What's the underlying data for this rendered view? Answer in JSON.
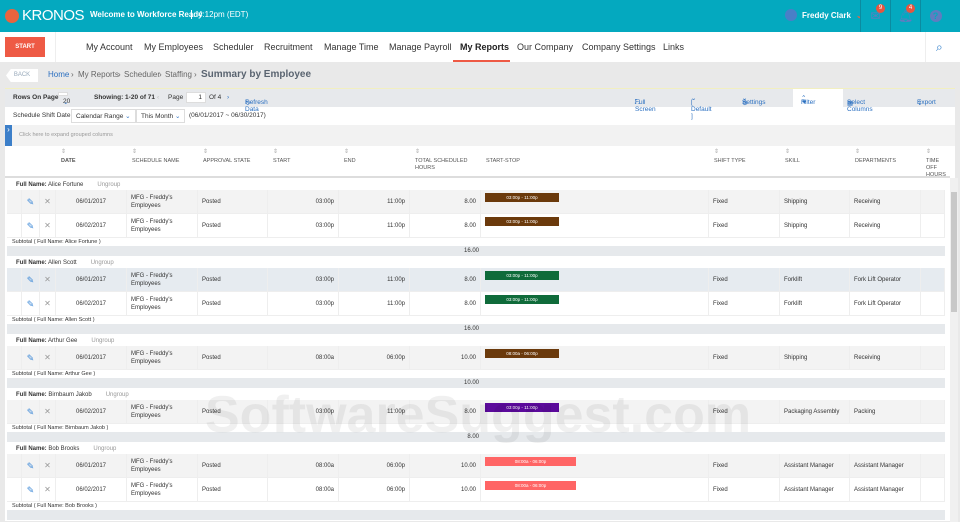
{
  "header": {
    "logo": "KRONOS",
    "welcome": "Welcome to Workforce Ready",
    "time": "4:12pm (EDT)",
    "user": "Freddy Clark",
    "mail_badge": "9",
    "bell_badge": "4"
  },
  "nav": {
    "start": "START",
    "items": [
      "My Account",
      "My Employees",
      "Scheduler",
      "Recruitment",
      "Manage Time",
      "Manage Payroll",
      "My Reports",
      "Our Company",
      "Company Settings",
      "Links"
    ],
    "active": "My Reports"
  },
  "breadcrumb": {
    "back": "BACK",
    "items": [
      "Home",
      "My Reports",
      "Scheduler",
      "Staffing"
    ],
    "title": "Summary by Employee"
  },
  "toolbar": {
    "rows_label": "Rows On Page",
    "rows_value": "20",
    "showing": "Showing: 1-20 of 71",
    "page_label": "Page",
    "page_value": "1",
    "of": "Of 4",
    "refresh": "Refresh Data",
    "full_screen": "Full Screen",
    "view": "[ Default ]",
    "settings": "Settings",
    "filter": "Filter",
    "select_columns": "Select Columns",
    "export": "Export"
  },
  "filter": {
    "label": "Schedule Shift Date:",
    "range": "Calendar Range",
    "period": "This Month",
    "dates": "(06/01/2017 ~ 06/30/2017)"
  },
  "expand_hint": "Click here to expand grouped columns",
  "columns": [
    "Date",
    "Schedule Name",
    "Approval State",
    "Start",
    "End",
    "Total Scheduled Hours",
    "Start-Stop",
    "Shift Type",
    "Skill",
    "Departments",
    "Time Off Hours"
  ],
  "groups": [
    {
      "label": "Full Name:",
      "name": "Alice Fortune",
      "ungroup": "Ungroup",
      "subtotal": "Subtotal ( Full Name: Alice Fortune )",
      "total": "16.00",
      "rows": [
        {
          "date": "06/01/2017",
          "schedule": "MFG - Freddy's Employees",
          "state": "Posted",
          "start": "03:00p",
          "end": "11:00p",
          "hours": "8.00",
          "bar": "03:00p - 11:00p",
          "color": "#6b3a0c",
          "shift": "Fixed",
          "skill": "Shipping",
          "dept": "Receiving"
        },
        {
          "date": "06/02/2017",
          "schedule": "MFG - Freddy's Employees",
          "state": "Posted",
          "start": "03:00p",
          "end": "11:00p",
          "hours": "8.00",
          "bar": "03:00p - 11:00p",
          "color": "#6b3a0c",
          "shift": "Fixed",
          "skill": "Shipping",
          "dept": "Receiving"
        }
      ]
    },
    {
      "label": "Full Name:",
      "name": "Allen Scott",
      "ungroup": "Ungroup",
      "subtotal": "Subtotal ( Full Name: Allen Scott )",
      "total": "16.00",
      "rows": [
        {
          "date": "06/01/2017",
          "schedule": "MFG - Freddy's Employees",
          "state": "Posted",
          "start": "03:00p",
          "end": "11:00p",
          "hours": "8.00",
          "bar": "03:00p - 11:00p",
          "color": "#0f6b3a",
          "shift": "Fixed",
          "skill": "Forklift",
          "dept": "Fork Lift Operator"
        },
        {
          "date": "06/02/2017",
          "schedule": "MFG - Freddy's Employees",
          "state": "Posted",
          "start": "03:00p",
          "end": "11:00p",
          "hours": "8.00",
          "bar": "03:00p - 11:00p",
          "color": "#0f6b3a",
          "shift": "Fixed",
          "skill": "Forklift",
          "dept": "Fork Lift Operator"
        }
      ]
    },
    {
      "label": "Full Name:",
      "name": "Arthur Gee",
      "ungroup": "Ungroup",
      "subtotal": "Subtotal ( Full Name: Arthur Gee )",
      "total": "10.00",
      "rows": [
        {
          "date": "06/01/2017",
          "schedule": "MFG - Freddy's Employees",
          "state": "Posted",
          "start": "08:00a",
          "end": "06:00p",
          "hours": "10.00",
          "bar": "08:00a - 06:00p",
          "color": "#6b3a0c",
          "shift": "Fixed",
          "skill": "Shipping",
          "dept": "Receiving"
        }
      ]
    },
    {
      "label": "Full Name:",
      "name": "Birnbaum Jakob",
      "ungroup": "Ungroup",
      "subtotal": "Subtotal ( Full Name: Birnbaum Jakob )",
      "total": "8.00",
      "rows": [
        {
          "date": "06/02/2017",
          "schedule": "MFG - Freddy's Employees",
          "state": "Posted",
          "start": "03:00p",
          "end": "11:00p",
          "hours": "8.00",
          "bar": "03:00p - 11:00p",
          "color": "#5b0a9b",
          "shift": "Fixed",
          "skill": "Packaging Assembly",
          "dept": "Packing"
        }
      ]
    },
    {
      "label": "Full Name:",
      "name": "Bob Brooks",
      "ungroup": "Ungroup",
      "subtotal": "Subtotal ( Full Name: Bob Brooks )",
      "total": "",
      "rows": [
        {
          "date": "06/01/2017",
          "schedule": "MFG - Freddy's Employees",
          "state": "Posted",
          "start": "08:00a",
          "end": "06:00p",
          "hours": "10.00",
          "bar": "08:00a - 06:00p",
          "color": "#ff6565",
          "shift": "Fixed",
          "skill": "Assistant Manager",
          "dept": "Assistant Manager"
        },
        {
          "date": "06/02/2017",
          "schedule": "MFG - Freddy's Employees",
          "state": "Posted",
          "start": "08:00a",
          "end": "06:00p",
          "hours": "10.00",
          "bar": "08:00a - 06:00p",
          "color": "#ff6565",
          "shift": "Fixed",
          "skill": "Assistant Manager",
          "dept": "Assistant Manager"
        }
      ]
    }
  ],
  "watermark": "SoftwareSuggest.com"
}
